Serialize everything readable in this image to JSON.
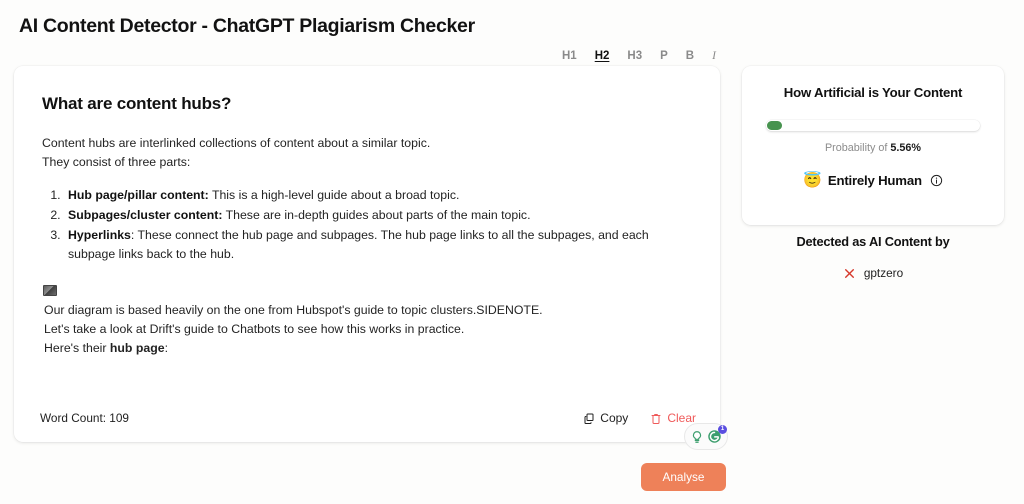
{
  "page": {
    "title": "AI Content Detector - ChatGPT Plagiarism Checker",
    "background_color": "#fdfdfc"
  },
  "format_toolbar": {
    "items": [
      {
        "label": "H1",
        "active": false
      },
      {
        "label": "H2",
        "active": true
      },
      {
        "label": "H3",
        "active": false
      },
      {
        "label": "P",
        "active": false
      },
      {
        "label": "B",
        "active": false
      },
      {
        "label": "I",
        "active": false
      }
    ]
  },
  "editor": {
    "heading": "What are content hubs?",
    "intro_line_1": "Content hubs are interlinked collections of content about a similar topic.",
    "intro_line_2": "They consist of three parts:",
    "list": [
      {
        "term": "Hub page/pillar content:",
        "text": " This is a high-level guide about a broad topic."
      },
      {
        "term": "Subpages/cluster content:",
        "text": " These are in-depth guides about parts of the main topic."
      },
      {
        "term": "Hyperlinks",
        "text": ": These connect the hub page and subpages. The hub page links to all the subpages, and each subpage links back to the hub."
      }
    ],
    "image_placeholder_icon": "broken-image-icon",
    "after_image_line_1": "Our diagram is based heavily on the one from Hubspot's guide to topic clusters.SIDENOTE.",
    "after_image_line_2": "Let's take a look at Drift's guide to Chatbots to see how this works in practice.",
    "after_image_line_3_prefix": "Here's their ",
    "after_image_line_3_bold": "hub page",
    "after_image_line_3_suffix": ":",
    "word_count_label": "Word Count: 109",
    "copy_label": "Copy",
    "copy_icon": "copy-icon",
    "clear_label": "Clear",
    "clear_icon": "trash-icon",
    "clear_color": "#ef5a5a"
  },
  "grammarly": {
    "bulb_icon": "lightbulb-icon",
    "logo_icon": "grammarly-g-icon",
    "badge_count": "1",
    "badge_color": "#5a4ee0",
    "accent_color": "#3c9e6e"
  },
  "score_panel": {
    "title": "How Artificial is Your Content",
    "meter": {
      "value_percent": 5.56,
      "knob_color": "#47934f",
      "track_color": "#ffffff"
    },
    "probability_prefix": "Probability of ",
    "probability_value": "5.56%",
    "verdict_emoji": "😇",
    "verdict_label": "Entirely Human",
    "info_icon": "info-circle-icon"
  },
  "detected_panel": {
    "heading": "Detected as AI Content by",
    "detectors": [
      {
        "icon": "x-mark-icon",
        "icon_color": "#d6392c",
        "name": "gptzero"
      }
    ]
  },
  "analyse_button": {
    "label": "Analyse",
    "color": "#ee8159"
  }
}
